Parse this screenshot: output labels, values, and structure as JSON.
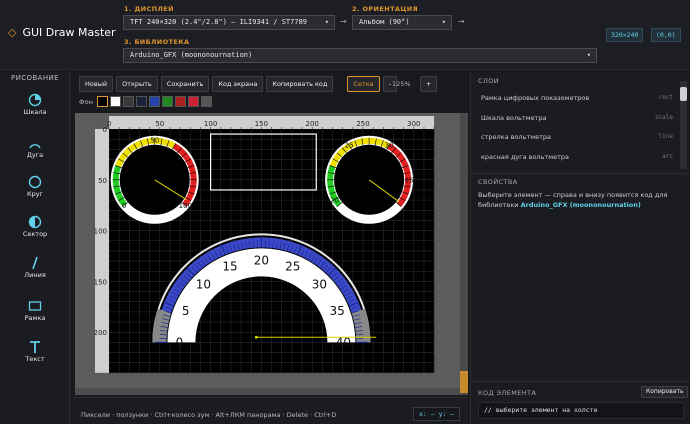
{
  "app": {
    "title": "GUI Draw Master"
  },
  "header": {
    "display": {
      "label": "1. ДИСПЛЕЙ",
      "value": "TFT 240×320 (2.4\"/2.8\") — ILI9341 / ST7789"
    },
    "orientation": {
      "label": "2. ОРИЕНТАЦИЯ",
      "value": "Альбом (90°)"
    },
    "library": {
      "label": "3. БИБЛИОТЕКА",
      "value": "Arduino_GFX (moononournation)"
    },
    "resolution": "320×240",
    "coords": "(0,0)"
  },
  "sidebar": {
    "title": "РИСОВАНИЕ",
    "tools": [
      {
        "label": "Шкала",
        "icon": "gauge-icon"
      },
      {
        "label": "Дуга",
        "icon": "arc-icon"
      },
      {
        "label": "Круг",
        "icon": "circle-icon"
      },
      {
        "label": "Сектор",
        "icon": "sector-icon"
      },
      {
        "label": "Линия",
        "icon": "line-icon"
      },
      {
        "label": "Рамка",
        "icon": "frame-icon"
      },
      {
        "label": "Текст",
        "icon": "text-icon"
      }
    ]
  },
  "toolbar": {
    "new": "Новый",
    "open": "Открыть",
    "save": "Сохранить",
    "screen_code": "Код экрана",
    "copy_code": "Копировать код",
    "grid": "Сетка",
    "zoom_out": "-",
    "zoom": "125%",
    "zoom_in": "+"
  },
  "background": {
    "label": "Фон",
    "swatches": [
      "#000000",
      "#ffffff",
      "#3a3a3a",
      "#1a2238",
      "#2244aa",
      "#228822",
      "#aa2222",
      "#cc2233",
      "#555555"
    ]
  },
  "canvas": {
    "x_ticks": [
      "0",
      "50",
      "100",
      "150",
      "200",
      "250",
      "300"
    ],
    "y_ticks": [
      "0",
      "50",
      "100",
      "150",
      "200"
    ],
    "big_gauge_labels": [
      "0",
      "5",
      "10",
      "15",
      "20",
      "25",
      "30",
      "35",
      "40"
    ],
    "small_left_labels": [
      "0",
      "50",
      "100"
    ],
    "small_right_labels": [
      "20",
      "25",
      "30",
      "25"
    ]
  },
  "status": {
    "hint": "Пиксели · ползунки · Ctrl+колесо зум · Alt+ЛКМ панорама · Delete · Ctrl+D",
    "xy": "x: –  y: –"
  },
  "layers": {
    "title": "СЛОИ",
    "items": [
      {
        "name": "Рамка цифровых показометров",
        "type": "rect"
      },
      {
        "name": "Шкала вольтметра",
        "type": "scale"
      },
      {
        "name": "стрелка вольтметра",
        "type": "line"
      },
      {
        "name": "красная дуга вольтметра",
        "type": "arc"
      }
    ]
  },
  "properties": {
    "title": "СВОЙСТВА",
    "text": "Выберите элемент — справа и внизу появится код для библиотеки",
    "library": "Arduino_GFX (moononournation)"
  },
  "code": {
    "title": "КОД ЭЛЕМЕНТА",
    "copy": "Копировать",
    "placeholder": "// выберите элемент на холсте"
  }
}
